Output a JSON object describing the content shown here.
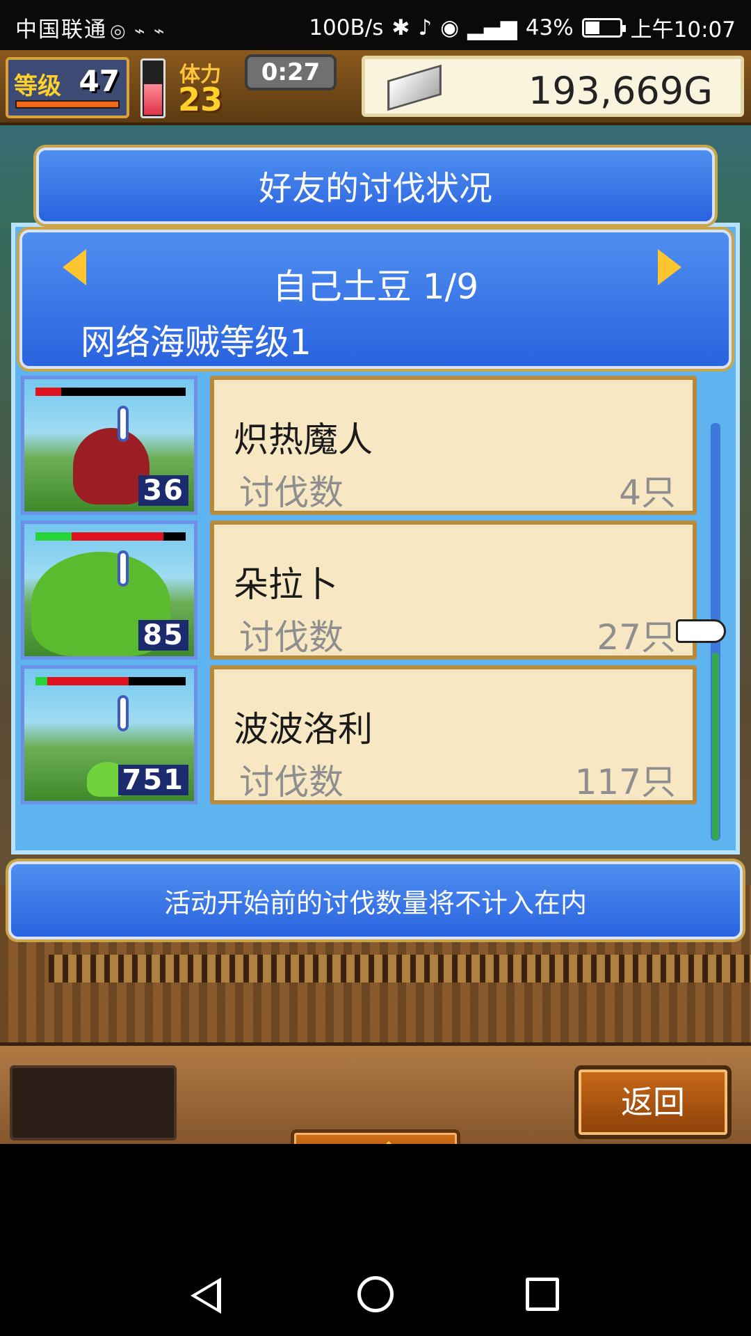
{
  "status_bar": {
    "carrier": "中国联通",
    "net_speed": "100B/s",
    "battery": "43%",
    "time": "上午10:07"
  },
  "hud": {
    "level_label": "等级",
    "level": "47",
    "stamina_label": "体力",
    "stamina": "23",
    "timer": "0:27",
    "gold": "193,669G"
  },
  "dialog": {
    "title": "好友的讨伐状况",
    "friend": "自己土豆 1/9",
    "subtitle": "网络海贼等级1",
    "rows": [
      {
        "name": "炽热魔人",
        "label": "讨伐数",
        "count": "4只",
        "level": "36",
        "hp_percent": 0.17
      },
      {
        "name": "朵拉卜",
        "label": "讨伐数",
        "count": "27只",
        "level": "85",
        "hp_percent": 0.85
      },
      {
        "name": "波波洛利",
        "label": "讨伐数",
        "count": "117只",
        "level": "751",
        "hp_percent": 0.62
      }
    ],
    "notice": "活动开始前的讨伐数量将不计入在内"
  },
  "buttons": {
    "back": "返回"
  },
  "icons": [
    "left-arrow-icon",
    "right-arrow-icon",
    "pointing-hand-icon",
    "up-arrow-icon",
    "silver-coin-icon"
  ],
  "colors": {
    "panel_blue": "#2a63df",
    "card": "#f7e7c3",
    "gold_trim": "#caa64a"
  }
}
